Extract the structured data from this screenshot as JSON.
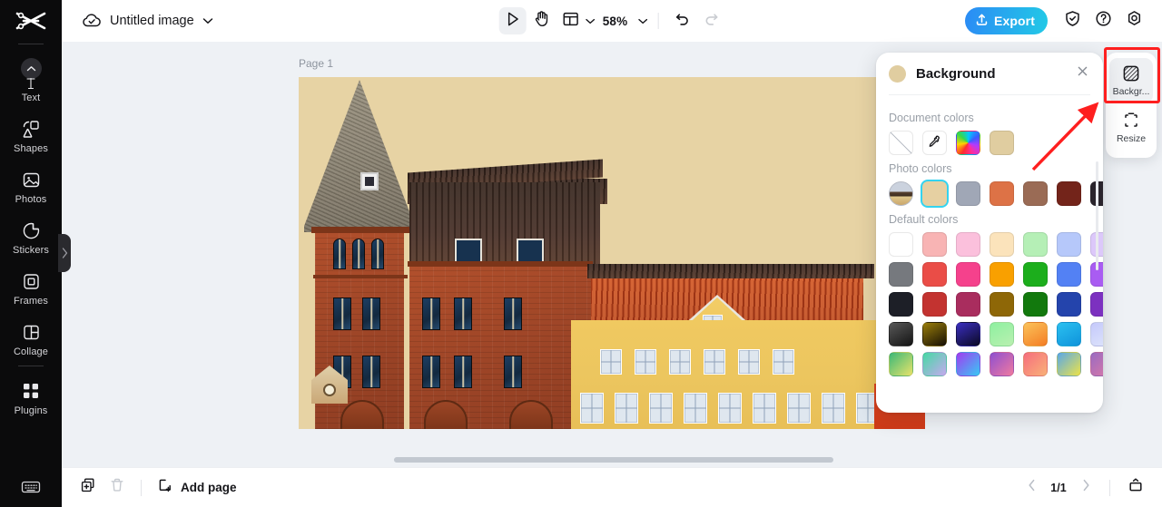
{
  "sidebar": {
    "logo_name": "capcut-logo",
    "items": [
      {
        "label": "Text",
        "icon": "text-icon"
      },
      {
        "label": "Shapes",
        "icon": "shapes-icon"
      },
      {
        "label": "Photos",
        "icon": "photos-icon"
      },
      {
        "label": "Stickers",
        "icon": "stickers-icon"
      },
      {
        "label": "Frames",
        "icon": "frames-icon"
      },
      {
        "label": "Collage",
        "icon": "collage-icon"
      },
      {
        "label": "Plugins",
        "icon": "plugins-icon"
      }
    ],
    "bottom_icon": "keyboard-shortcuts-icon",
    "collapse_icon": "chevron-right-icon"
  },
  "topbar": {
    "cloud_icon": "cloud-saved-icon",
    "doc_title": "Untitled image",
    "title_chevron": "chevron-down-icon",
    "tools": {
      "select_icon": "cursor-select-icon",
      "hand_icon": "hand-pan-icon",
      "layout_icon": "layout-grid-icon",
      "layout_chevron": "chevron-down-icon",
      "zoom_value": "58%",
      "zoom_chevron": "chevron-down-icon",
      "undo_icon": "undo-icon",
      "redo_icon": "redo-icon"
    },
    "export_label": "Export",
    "export_icon": "upload-icon",
    "export_color": "#22b5ec",
    "shield_icon": "shield-check-icon",
    "help_icon": "help-circle-icon",
    "settings_icon": "settings-gear-icon"
  },
  "canvas": {
    "page_label": "Page 1",
    "background_color": "#e7d3a4",
    "scrollbar_name": "horizontal-scrollbar"
  },
  "background_panel": {
    "title": "Background",
    "header_swatch_color": "#e0cda0",
    "close_icon": "close-icon",
    "sections": [
      {
        "title": "Document colors",
        "swatches": [
          {
            "name": "no-color-swatch",
            "type": "none",
            "color": "#ffffff"
          },
          {
            "name": "eyedropper-swatch",
            "type": "dropper",
            "color": "#ffffff"
          },
          {
            "name": "color-picker-swatch",
            "type": "rainbow",
            "color": "rainbow"
          },
          {
            "name": "document-color-tan",
            "type": "solid",
            "color": "#e0cda0"
          }
        ]
      },
      {
        "title": "Photo colors",
        "swatches": [
          {
            "name": "photo-thumbnail-swatch",
            "type": "photo",
            "color": "#c6ccd8"
          },
          {
            "name": "photo-color-tan",
            "type": "solid",
            "color": "#e6d0a2",
            "selected": true
          },
          {
            "name": "photo-color-gray-blue",
            "type": "solid",
            "color": "#a0a7b6"
          },
          {
            "name": "photo-color-orange",
            "type": "solid",
            "color": "#dd7246"
          },
          {
            "name": "photo-color-brown",
            "type": "solid",
            "color": "#9a6b55"
          },
          {
            "name": "photo-color-dark-red",
            "type": "solid",
            "color": "#73241a"
          },
          {
            "name": "photo-color-near-black",
            "type": "solid",
            "color": "#2a242c"
          }
        ]
      },
      {
        "title": "Default colors",
        "rows": [
          [
            {
              "name": "default-white",
              "color": "#ffffff"
            },
            {
              "name": "default-light-salmon",
              "color": "#f8b4b4"
            },
            {
              "name": "default-light-pink",
              "color": "#fbc0dc"
            },
            {
              "name": "default-light-peach",
              "color": "#fbe3bb"
            },
            {
              "name": "default-light-green",
              "color": "#b5efb6"
            },
            {
              "name": "default-light-blue",
              "color": "#b6c8fa"
            },
            {
              "name": "default-light-purple",
              "color": "#dcc8fa"
            }
          ],
          [
            {
              "name": "default-gray",
              "color": "#76797e"
            },
            {
              "name": "default-red",
              "color": "#ea4d47"
            },
            {
              "name": "default-pink",
              "color": "#f5418c"
            },
            {
              "name": "default-orange",
              "color": "#f9a000"
            },
            {
              "name": "default-green",
              "color": "#1cae1c"
            },
            {
              "name": "default-blue",
              "color": "#5381f4"
            },
            {
              "name": "default-purple",
              "color": "#a95cf2"
            }
          ],
          [
            {
              "name": "default-black",
              "color": "#1d1f27"
            },
            {
              "name": "default-dark-red",
              "color": "#c33330"
            },
            {
              "name": "default-magenta",
              "color": "#a92d5e"
            },
            {
              "name": "default-olive",
              "color": "#8e6707"
            },
            {
              "name": "default-dark-green",
              "color": "#12790d"
            },
            {
              "name": "default-navy",
              "color": "#2444ac"
            },
            {
              "name": "default-violet",
              "color": "#7c31c0"
            }
          ],
          [
            {
              "name": "gradient-black",
              "color": "linear-gradient(150deg,#585858,#141414)"
            },
            {
              "name": "gradient-gold-black",
              "color": "linear-gradient(150deg,#9a7e0a,#171005)"
            },
            {
              "name": "gradient-indigo-black",
              "color": "linear-gradient(150deg,#3a2ec0,#0b0a24)"
            },
            {
              "name": "gradient-green-mint",
              "color": "linear-gradient(150deg,#8ef0a0,#b9f0b0)"
            },
            {
              "name": "gradient-orange",
              "color": "linear-gradient(150deg,#fbc35a,#f47d24)"
            },
            {
              "name": "gradient-cyan-blue",
              "color": "linear-gradient(150deg,#2bc0f0,#0f93db)"
            },
            {
              "name": "gradient-lavender",
              "color": "linear-gradient(150deg,#c5c9fb,#dfe6fb)"
            }
          ],
          [
            {
              "name": "gradient-green-yellow",
              "color": "linear-gradient(135deg,#3cb878,#e8e36a)"
            },
            {
              "name": "gradient-mint-lilac",
              "color": "linear-gradient(135deg,#45d9a4,#c5a9ef)"
            },
            {
              "name": "gradient-purple-cyan",
              "color": "linear-gradient(135deg,#a23bf0,#37c9f5)"
            },
            {
              "name": "gradient-violet-rose",
              "color": "linear-gradient(135deg,#8e4fd0,#f07aa0)"
            },
            {
              "name": "gradient-salmon-peach",
              "color": "linear-gradient(135deg,#f66e7e,#f9b178)"
            },
            {
              "name": "gradient-blue-yellow",
              "color": "linear-gradient(135deg,#59a8e8,#ece349)"
            },
            {
              "name": "gradient-plum-rose",
              "color": "linear-gradient(135deg,#9a6bc2,#e07aa4)"
            }
          ]
        ]
      }
    ]
  },
  "right_rail": {
    "buttons": [
      {
        "label": "Backgr...",
        "icon": "background-hatch-icon",
        "active": true
      },
      {
        "label": "Resize",
        "icon": "resize-crop-icon",
        "active": false
      }
    ],
    "highlight_color": "#fe1f1f",
    "annotation": "red-arrow-pointing-to-background-button"
  },
  "bottombar": {
    "duplicate_icon": "duplicate-page-icon",
    "delete_icon": "trash-icon",
    "add_page_icon": "add-page-icon",
    "add_page_label": "Add page",
    "prev_icon": "chevron-left-icon",
    "page_count": "1/1",
    "next_icon": "chevron-right-icon",
    "present_icon": "present-icon"
  }
}
